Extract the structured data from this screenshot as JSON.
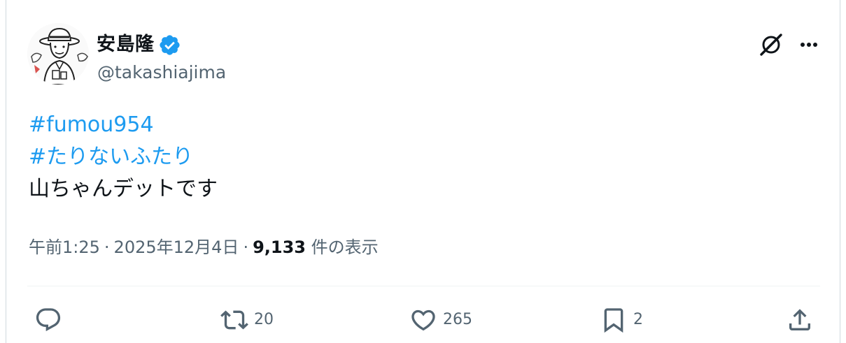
{
  "author": {
    "display_name": "安島隆",
    "handle": "@takashiajima",
    "verified": true
  },
  "tweet": {
    "hashtags": [
      "#fumou954",
      "#たりないふたり"
    ],
    "text": "山ちゃんデットです"
  },
  "meta": {
    "time": "午前1:25",
    "separator": "·",
    "date": "2025年12月4日",
    "views_count": "9,133",
    "views_label": " 件の表示"
  },
  "actions": {
    "reply_count": "",
    "retweet_count": "20",
    "like_count": "265",
    "bookmark_count": "2"
  },
  "colors": {
    "text": "#0f1419",
    "secondary": "#536471",
    "link": "#1d9bf0",
    "verified": "#1d9bf0",
    "divider": "#eff3f4"
  }
}
